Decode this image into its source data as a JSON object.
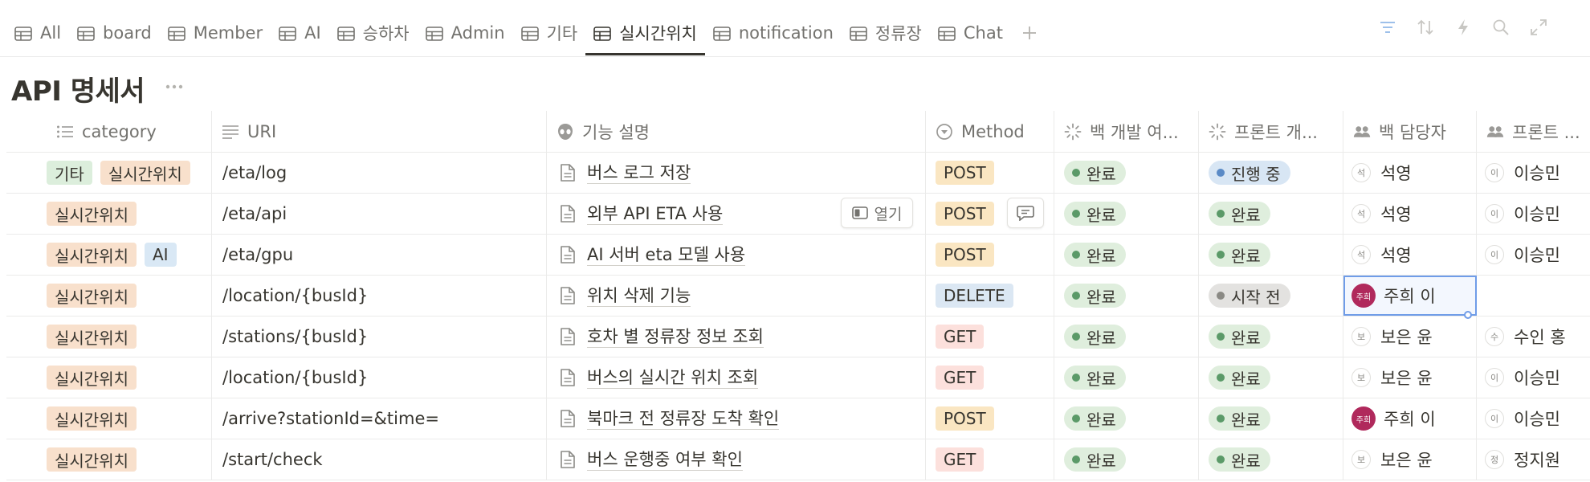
{
  "tabs": [
    {
      "label": "All"
    },
    {
      "label": "board"
    },
    {
      "label": "Member"
    },
    {
      "label": "AI"
    },
    {
      "label": "승하차"
    },
    {
      "label": "Admin"
    },
    {
      "label": "기타"
    },
    {
      "label": "실시간위치",
      "active": true
    },
    {
      "label": "notification"
    },
    {
      "label": "정류장"
    },
    {
      "label": "Chat"
    }
  ],
  "toolbar": {
    "icons": [
      "filter-icon",
      "sort-icon",
      "lightning-icon",
      "search-icon",
      "expand-icon"
    ]
  },
  "title": "API 명세서",
  "columns": [
    "category",
    "URI",
    "기능 설명",
    "Method",
    "백 개발 여...",
    "프론트 개...",
    "백 담당자",
    "프론트 ..."
  ],
  "open_label": "열기",
  "colors": {
    "tag_orange": "#f8e0cc",
    "tag_green": "#dceedc",
    "tag_blue": "#d9e8f5",
    "post": "#fae6c2",
    "get": "#fce0dc",
    "delete": "#dbe7f3",
    "status_done_bg": "#dfeedd",
    "status_done_dot": "#5b9a68",
    "status_progress_bg": "#d8e6f4",
    "status_progress_dot": "#5a8ac6",
    "status_todo_bg": "#e3e2e0",
    "status_todo_dot": "#8a8984",
    "selection": "#6f9ce8"
  },
  "rows": [
    {
      "tags": [
        {
          "label": "기타",
          "color": "green"
        },
        {
          "label": "실시간위치",
          "color": "orange"
        }
      ],
      "uri": "/eta/log",
      "desc": "버스 로그 저장",
      "method": "POST",
      "back_status": {
        "label": "완료",
        "kind": "done"
      },
      "front_status": {
        "label": "진행 중",
        "kind": "progress"
      },
      "back_owner": {
        "initial": "석",
        "name": "석영"
      },
      "front_owner": {
        "initial": "이",
        "name": "이승민"
      }
    },
    {
      "tags": [
        {
          "label": "실시간위치",
          "color": "orange"
        }
      ],
      "uri": "/eta/api",
      "desc": "외부 API ETA 사용",
      "method": "POST",
      "back_status": {
        "label": "완료",
        "kind": "done"
      },
      "front_status": {
        "label": "완료",
        "kind": "done"
      },
      "back_owner": {
        "initial": "석",
        "name": "석영"
      },
      "front_owner": {
        "initial": "이",
        "name": "이승민"
      }
    },
    {
      "tags": [
        {
          "label": "실시간위치",
          "color": "orange"
        },
        {
          "label": "AI",
          "color": "blue"
        }
      ],
      "uri": "/eta/gpu",
      "desc": "AI 서버 eta 모델 사용",
      "method": "POST",
      "back_status": {
        "label": "완료",
        "kind": "done"
      },
      "front_status": {
        "label": "완료",
        "kind": "done"
      },
      "back_owner": {
        "initial": "석",
        "name": "석영"
      },
      "front_owner": {
        "initial": "이",
        "name": "이승민"
      }
    },
    {
      "tags": [
        {
          "label": "실시간위치",
          "color": "orange"
        }
      ],
      "uri": "/location/{busId}",
      "desc": "위치 삭제 기능",
      "method": "DELETE",
      "back_status": {
        "label": "완료",
        "kind": "done"
      },
      "front_status": {
        "label": "시작 전",
        "kind": "todo"
      },
      "back_owner": {
        "initial": "주희",
        "name": "주희 이",
        "photo": true
      },
      "front_owner": null
    },
    {
      "tags": [
        {
          "label": "실시간위치",
          "color": "orange"
        }
      ],
      "uri": "/stations/{busId}",
      "desc": "호차 별 정류장 정보 조회",
      "method": "GET",
      "back_status": {
        "label": "완료",
        "kind": "done"
      },
      "front_status": {
        "label": "완료",
        "kind": "done"
      },
      "back_owner": {
        "initial": "보",
        "name": "보은 윤"
      },
      "front_owner": {
        "initial": "수",
        "name": "수인 홍"
      }
    },
    {
      "tags": [
        {
          "label": "실시간위치",
          "color": "orange"
        }
      ],
      "uri": "/location/{busId}",
      "desc": "버스의 실시간 위치 조회",
      "method": "GET",
      "back_status": {
        "label": "완료",
        "kind": "done"
      },
      "front_status": {
        "label": "완료",
        "kind": "done"
      },
      "back_owner": {
        "initial": "보",
        "name": "보은 윤"
      },
      "front_owner": {
        "initial": "이",
        "name": "이승민"
      }
    },
    {
      "tags": [
        {
          "label": "실시간위치",
          "color": "orange"
        }
      ],
      "uri": "/arrive?stationId=&time=",
      "desc": "북마크 전 정류장 도착 확인",
      "method": "POST",
      "back_status": {
        "label": "완료",
        "kind": "done"
      },
      "front_status": {
        "label": "완료",
        "kind": "done"
      },
      "back_owner": {
        "initial": "주희",
        "name": "주희 이",
        "photo": true
      },
      "front_owner": {
        "initial": "이",
        "name": "이승민"
      }
    },
    {
      "tags": [
        {
          "label": "실시간위치",
          "color": "orange"
        }
      ],
      "uri": "/start/check",
      "desc": "버스 운행중 여부 확인",
      "method": "GET",
      "back_status": {
        "label": "완료",
        "kind": "done"
      },
      "front_status": {
        "label": "완료",
        "kind": "done"
      },
      "back_owner": {
        "initial": "보",
        "name": "보은 윤"
      },
      "front_owner": {
        "initial": "정",
        "name": "정지원"
      }
    }
  ]
}
